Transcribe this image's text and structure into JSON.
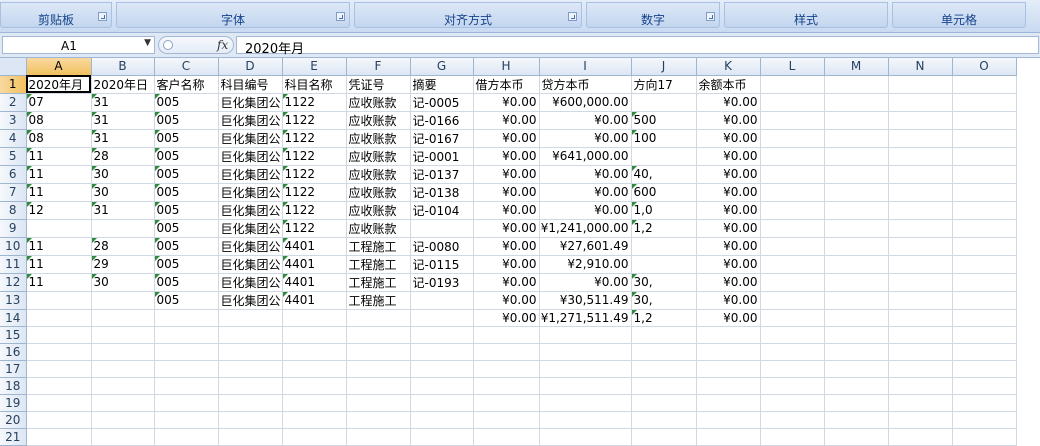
{
  "ribbon": {
    "groups": [
      {
        "label": "剪贴板"
      },
      {
        "label": "字体"
      },
      {
        "label": "对齐方式"
      },
      {
        "label": "数字"
      },
      {
        "label": "样式"
      },
      {
        "label": "单元格"
      }
    ]
  },
  "formula_bar": {
    "name_box": "A1",
    "fx": "fx",
    "value": "2020年月"
  },
  "columns": [
    "A",
    "B",
    "C",
    "D",
    "E",
    "F",
    "G",
    "H",
    "I",
    "J",
    "K",
    "L",
    "M",
    "N",
    "O"
  ],
  "rows": [
    {
      "n": "1",
      "cells": [
        "2020年月",
        "2020年日",
        "客户名称",
        "科目编号",
        "科目名称",
        "凭证号",
        "摘要",
        "借方本币",
        "贷方本币",
        "方向17",
        "余额本币",
        "",
        "",
        "",
        ""
      ]
    },
    {
      "n": "2",
      "cells": [
        "07",
        "31",
        "005",
        "巨化集团公",
        "1122",
        "应收账款",
        "记-0005",
        "¥0.00",
        "¥600,000.00",
        "",
        "¥0.00",
        "",
        "",
        "",
        ""
      ]
    },
    {
      "n": "3",
      "cells": [
        "08",
        "31",
        "005",
        "巨化集团公",
        "1122",
        "应收账款",
        "记-0166",
        "¥0.00",
        "¥0.00",
        "500",
        "¥0.00",
        "",
        "",
        "",
        ""
      ]
    },
    {
      "n": "4",
      "cells": [
        "08",
        "31",
        "005",
        "巨化集团公",
        "1122",
        "应收账款",
        "记-0167",
        "¥0.00",
        "¥0.00",
        "100",
        "¥0.00",
        "",
        "",
        "",
        ""
      ]
    },
    {
      "n": "5",
      "cells": [
        "11",
        "28",
        "005",
        "巨化集团公",
        "1122",
        "应收账款",
        "记-0001",
        "¥0.00",
        "¥641,000.00",
        "",
        "¥0.00",
        "",
        "",
        "",
        ""
      ]
    },
    {
      "n": "6",
      "cells": [
        "11",
        "30",
        "005",
        "巨化集团公",
        "1122",
        "应收账款",
        "记-0137",
        "¥0.00",
        "¥0.00",
        "40,",
        "¥0.00",
        "",
        "",
        "",
        ""
      ]
    },
    {
      "n": "7",
      "cells": [
        "11",
        "30",
        "005",
        "巨化集团公",
        "1122",
        "应收账款",
        "记-0138",
        "¥0.00",
        "¥0.00",
        "600",
        "¥0.00",
        "",
        "",
        "",
        ""
      ]
    },
    {
      "n": "8",
      "cells": [
        "12",
        "31",
        "005",
        "巨化集团公",
        "1122",
        "应收账款",
        "记-0104",
        "¥0.00",
        "¥0.00",
        "1,0",
        "¥0.00",
        "",
        "",
        "",
        ""
      ]
    },
    {
      "n": "9",
      "cells": [
        "",
        "",
        "005",
        "巨化集团公",
        "1122",
        "应收账款",
        "",
        "¥0.00",
        "¥1,241,000.00",
        "1,2",
        "¥0.00",
        "",
        "",
        "",
        ""
      ]
    },
    {
      "n": "10",
      "cells": [
        "11",
        "28",
        "005",
        "巨化集团公",
        "4401",
        "工程施工",
        "记-0080",
        "¥0.00",
        "¥27,601.49",
        "",
        "¥0.00",
        "",
        "",
        "",
        ""
      ]
    },
    {
      "n": "11",
      "cells": [
        "11",
        "29",
        "005",
        "巨化集团公",
        "4401",
        "工程施工",
        "记-0115",
        "¥0.00",
        "¥2,910.00",
        "",
        "¥0.00",
        "",
        "",
        "",
        ""
      ]
    },
    {
      "n": "12",
      "cells": [
        "11",
        "30",
        "005",
        "巨化集团公",
        "4401",
        "工程施工",
        "记-0193",
        "¥0.00",
        "¥0.00",
        "30,",
        "¥0.00",
        "",
        "",
        "",
        ""
      ]
    },
    {
      "n": "13",
      "cells": [
        "",
        "",
        "005",
        "巨化集团公",
        "4401",
        "工程施工",
        "",
        "¥0.00",
        "¥30,511.49",
        "30,",
        "¥0.00",
        "",
        "",
        "",
        ""
      ]
    },
    {
      "n": "14",
      "cells": [
        "",
        "",
        "",
        "",
        "",
        "",
        "",
        "¥0.00",
        "¥1,271,511.49",
        "1,2",
        "¥0.00",
        "",
        "",
        "",
        ""
      ]
    },
    {
      "n": "15",
      "cells": [
        "",
        "",
        "",
        "",
        "",
        "",
        "",
        "",
        "",
        "",
        "",
        "",
        "",
        "",
        ""
      ]
    },
    {
      "n": "16",
      "cells": [
        "",
        "",
        "",
        "",
        "",
        "",
        "",
        "",
        "",
        "",
        "",
        "",
        "",
        "",
        ""
      ]
    },
    {
      "n": "17",
      "cells": [
        "",
        "",
        "",
        "",
        "",
        "",
        "",
        "",
        "",
        "",
        "",
        "",
        "",
        "",
        ""
      ]
    },
    {
      "n": "18",
      "cells": [
        "",
        "",
        "",
        "",
        "",
        "",
        "",
        "",
        "",
        "",
        "",
        "",
        "",
        "",
        ""
      ]
    },
    {
      "n": "19",
      "cells": [
        "",
        "",
        "",
        "",
        "",
        "",
        "",
        "",
        "",
        "",
        "",
        "",
        "",
        "",
        ""
      ]
    },
    {
      "n": "20",
      "cells": [
        "",
        "",
        "",
        "",
        "",
        "",
        "",
        "",
        "",
        "",
        "",
        "",
        "",
        "",
        ""
      ]
    },
    {
      "n": "21",
      "cells": [
        "",
        "",
        "",
        "",
        "",
        "",
        "",
        "",
        "",
        "",
        "",
        "",
        "",
        "",
        ""
      ]
    }
  ]
}
